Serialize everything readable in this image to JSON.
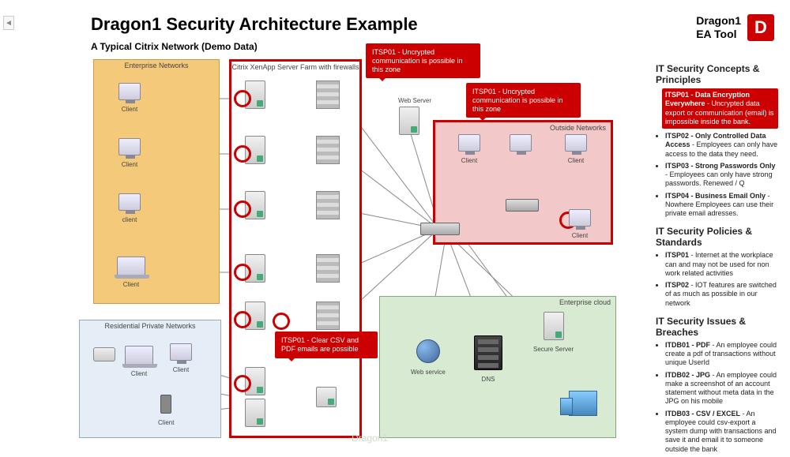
{
  "header": {
    "title": "Dragon1 Security Architecture Example",
    "subtitle": "A Typical Citrix Network (Demo Data)",
    "brand_name": "Dragon1",
    "brand_sub": "EA Tool",
    "brand_logo_letter": "D"
  },
  "zones": {
    "enterprise": "Enterprise Networks",
    "citrix": "Citrix XenApp Server Farm with firewalls",
    "outside": "Outside Networks",
    "cloud": "Enterprise cloud",
    "residential": "Residential Private Networks"
  },
  "callouts": {
    "c1": "ITSP01 - Uncrypted communication is possible in this zone",
    "c2": "ITSP01 - Uncrypted communication is possible in this zone",
    "c3": "ITSP01 - Clear CSV and PDF emails are possible"
  },
  "nodes": {
    "client": "Client",
    "client_lc": "client",
    "webserver": "Web Server",
    "router": "",
    "webservice": "Web service",
    "dns": "DNS",
    "secure_server": "Secure Server",
    "building": ""
  },
  "sidebar": {
    "s1": {
      "title": "IT Security Concepts & Principles",
      "items": [
        {
          "code": "ITSP01 - Data Encryption Everywhere",
          "text": " - Uncrypted data export or communication (email) is impossible inside the bank.",
          "highlight": true
        },
        {
          "code": "ITSP02 - Only Controlled Data Access",
          "text": " - Employees can only have access to the data they need."
        },
        {
          "code": "ITSP03 - Strong Passwords Only",
          "text": " - Employees can only have strong passwords. Renewed / Q"
        },
        {
          "code": "ITSP04 - Business Email Only",
          "text": " - Nowhere Employees can use their private email adresses."
        }
      ]
    },
    "s2": {
      "title": "IT Security Policies & Standards",
      "items": [
        {
          "code": "ITSP01",
          "text": " - Internet at the workplace can and may not be used for non work related activities"
        },
        {
          "code": "ITSP02",
          "text": " - IOT features are switched of as much as possible in our network"
        }
      ]
    },
    "s3": {
      "title": "IT Security Issues & Breaches",
      "items": [
        {
          "code": "ITDB01 - PDF",
          "text": " - An employee could create a pdf of transactions without unique UserId"
        },
        {
          "code": "ITDB02 - JPG",
          "text": " - An employee could make a screenshot of an account statement without meta data in the JPG on his mobile"
        },
        {
          "code": "ITDB03 - CSV / EXCEL",
          "text": " - An employee could csv-export a system dump with transactions and save it and email it to someone outside the bank"
        }
      ]
    }
  },
  "watermark": "Dragon1"
}
